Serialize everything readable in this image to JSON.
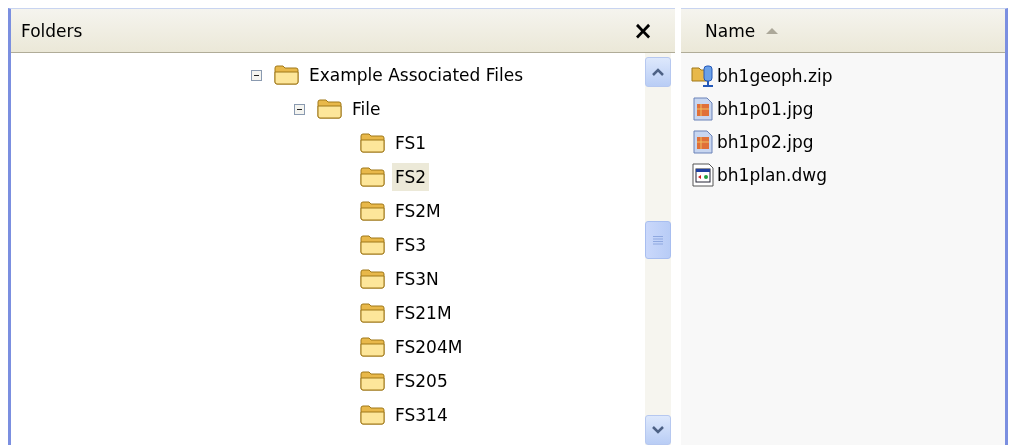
{
  "folders_pane": {
    "title": "Folders",
    "close": "×",
    "tree": [
      {
        "label": "Example Associated Files",
        "expanded": true,
        "selected": false,
        "children": [
          {
            "label": "File",
            "expanded": true,
            "selected": false,
            "children": [
              {
                "label": "FS1",
                "selected": false
              },
              {
                "label": "FS2",
                "selected": true
              },
              {
                "label": "FS2M",
                "selected": false
              },
              {
                "label": "FS3",
                "selected": false
              },
              {
                "label": "FS3N",
                "selected": false
              },
              {
                "label": "FS21M",
                "selected": false
              },
              {
                "label": "FS204M",
                "selected": false
              },
              {
                "label": "FS205",
                "selected": false
              },
              {
                "label": "FS314",
                "selected": false
              }
            ]
          }
        ]
      }
    ]
  },
  "file_list": {
    "columns": [
      {
        "label": "Name",
        "sorted": true
      }
    ],
    "files": [
      {
        "name": "bh1geoph.zip",
        "kind": "zip"
      },
      {
        "name": "bh1p01.jpg",
        "kind": "image"
      },
      {
        "name": "bh1p02.jpg",
        "kind": "image"
      },
      {
        "name": "bh1plan.dwg",
        "kind": "drawing"
      }
    ]
  }
}
